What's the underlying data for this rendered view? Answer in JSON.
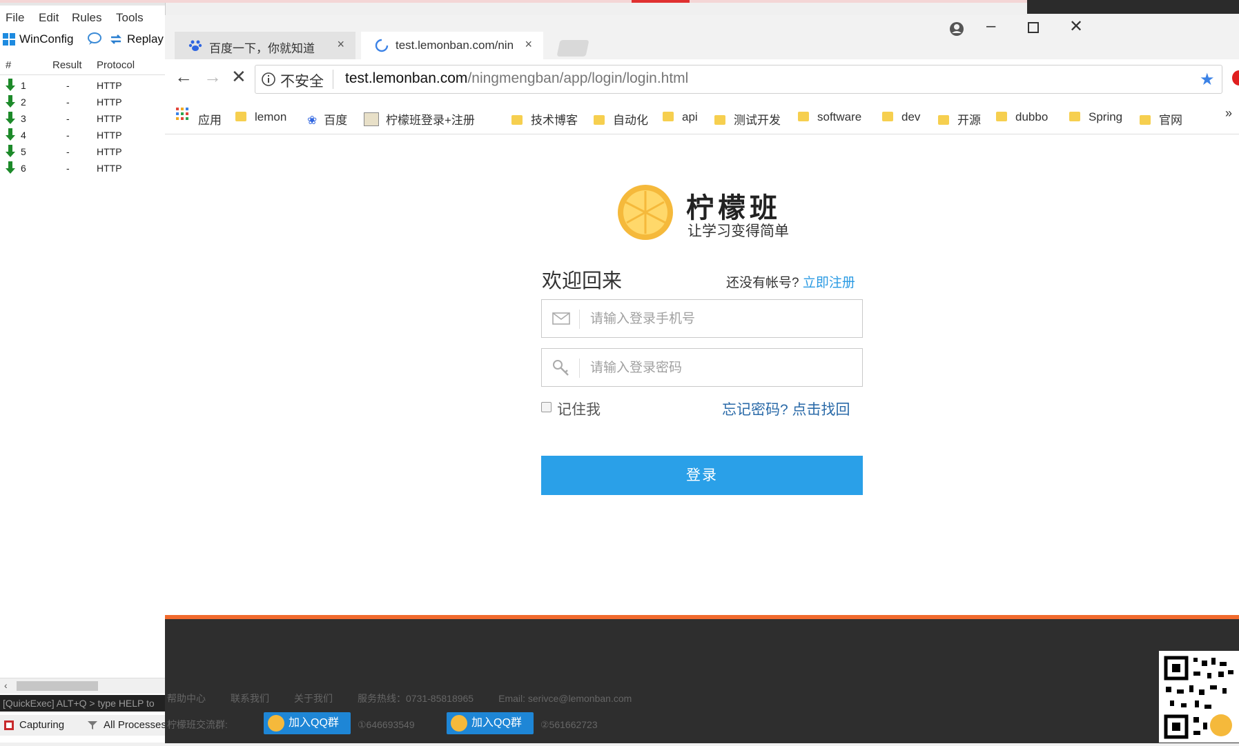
{
  "fiddler": {
    "menu": [
      "File",
      "Edit",
      "Rules",
      "Tools"
    ],
    "toolbar": {
      "winconfig": "WinConfig",
      "replay": "Replay"
    },
    "columns": {
      "hash": "#",
      "result": "Result",
      "protocol": "Protocol"
    },
    "sessions": [
      {
        "num": "1",
        "result": "-",
        "protocol": "HTTP"
      },
      {
        "num": "2",
        "result": "-",
        "protocol": "HTTP"
      },
      {
        "num": "3",
        "result": "-",
        "protocol": "HTTP"
      },
      {
        "num": "4",
        "result": "-",
        "protocol": "HTTP"
      },
      {
        "num": "5",
        "result": "-",
        "protocol": "HTTP"
      },
      {
        "num": "6",
        "result": "-",
        "protocol": "HTTP"
      }
    ],
    "quickexec": "[QuickExec] ALT+Q > type HELP to",
    "status": {
      "capturing": "Capturing",
      "processes": "All Processes"
    }
  },
  "browser": {
    "tabs": [
      {
        "title": "百度一下，你就知道",
        "close": "×"
      },
      {
        "title": "test.lemonban.com/nin",
        "close": "×"
      }
    ],
    "security": "不安全",
    "url_host": "test.lemonban.com",
    "url_path": "/ningmengban/app/login/login.html",
    "bookmarks": [
      {
        "label": "应用"
      },
      {
        "label": "lemon"
      },
      {
        "label": "百度"
      },
      {
        "label": "柠檬班登录+注册"
      },
      {
        "label": "技术博客"
      },
      {
        "label": "自动化"
      },
      {
        "label": "api"
      },
      {
        "label": "测试开发"
      },
      {
        "label": "software"
      },
      {
        "label": "dev"
      },
      {
        "label": "开源"
      },
      {
        "label": "dubbo"
      },
      {
        "label": "Spring"
      },
      {
        "label": "官网"
      }
    ],
    "more": "»"
  },
  "page": {
    "logo_title": "柠檬班",
    "logo_slogan": "让学习变得简单",
    "welcome": "欢迎回来",
    "no_account": "还没有帐号?",
    "register": "立即注册",
    "phone_placeholder": "请输入登录手机号",
    "password_placeholder": "请输入登录密码",
    "remember": "记住我",
    "forgot": "忘记密码? 点击找回",
    "login": "登录",
    "footer": {
      "links": [
        "帮助中心",
        "联系我们",
        "关于我们",
        "服务热线：0731-85818965",
        "Email: serivce@lemonban.com"
      ],
      "group_label": "柠檬班交流群:",
      "qq_button": "加入QQ群",
      "group1": "①646693549",
      "group2": "②561662723"
    }
  },
  "colors": {
    "accent": "#2aa0e8",
    "footer_line": "#f16a2d",
    "logo_yellow": "#f5b93b"
  }
}
